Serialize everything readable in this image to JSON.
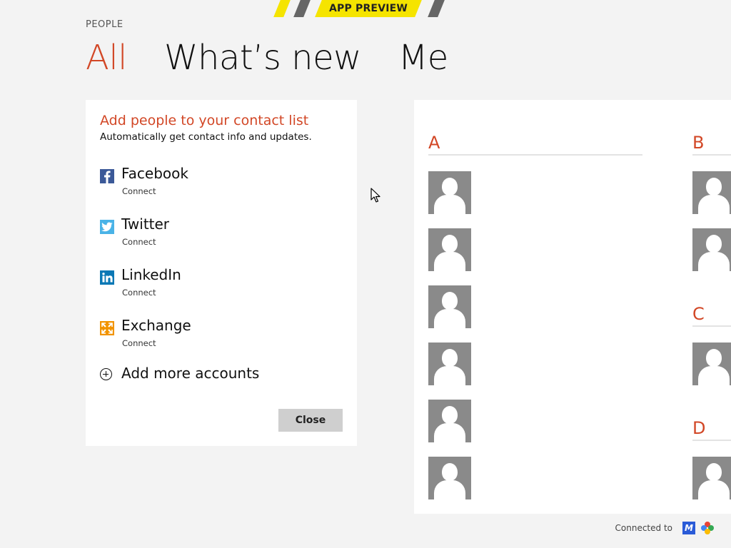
{
  "banner": {
    "label": "APP PREVIEW"
  },
  "app": {
    "name": "PEOPLE"
  },
  "pivots": [
    {
      "label": "All",
      "active": true
    },
    {
      "label": "What’s new",
      "active": false
    },
    {
      "label": "Me",
      "active": false
    }
  ],
  "panel": {
    "title": "Add people to your contact list",
    "subtitle": "Automatically get contact info and updates.",
    "accounts": [
      {
        "name": "Facebook",
        "action": "Connect",
        "icon": "facebook-icon",
        "color": "#3b5998"
      },
      {
        "name": "Twitter",
        "action": "Connect",
        "icon": "twitter-icon",
        "color": "#4ab3e7"
      },
      {
        "name": "LinkedIn",
        "action": "Connect",
        "icon": "linkedin-icon",
        "color": "#0b78b5"
      },
      {
        "name": "Exchange",
        "action": "Connect",
        "icon": "exchange-icon",
        "color": "#f29400"
      }
    ],
    "add_more": "Add more accounts",
    "close_label": "Close"
  },
  "contacts": {
    "groups": [
      "A",
      "B",
      "C",
      "D"
    ]
  },
  "footer": {
    "connected_to": "Connected to",
    "services": [
      "messenger-icon",
      "google-icon"
    ]
  },
  "colors": {
    "accent": "#d24726",
    "background": "#f3f3f3",
    "tile": "#8a8a8a",
    "banner": "#f5e400"
  }
}
